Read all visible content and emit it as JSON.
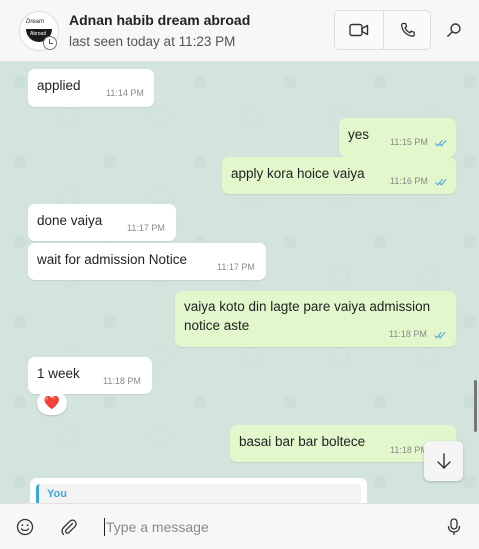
{
  "header": {
    "contact_name": "Adnan habib dream abroad",
    "last_seen": "last seen today at 11:23 PM",
    "avatar_text_top": "Dream",
    "avatar_text_bottom": "Abroad",
    "icons": [
      "video-call-icon",
      "voice-call-icon",
      "search-icon"
    ]
  },
  "messages": [
    {
      "dir": "in",
      "text": "applied",
      "time": "11:14 PM"
    },
    {
      "dir": "out",
      "text": "yes",
      "time": "11:15 PM",
      "read": true
    },
    {
      "dir": "out",
      "text": "apply kora hoice vaiya",
      "time": "11:16 PM",
      "read": true
    },
    {
      "dir": "in",
      "text": "done vaiya",
      "time": "11:17 PM"
    },
    {
      "dir": "in",
      "text": "wait for admission Notice",
      "time": "11:17 PM"
    },
    {
      "dir": "out",
      "text": "vaiya koto din lagte pare vaiya admission notice aste",
      "time": "11:18 PM",
      "read": true
    },
    {
      "dir": "in",
      "text": "1 week",
      "time": "11:18 PM",
      "reaction": "❤️"
    },
    {
      "dir": "out",
      "text": "basai bar bar boltece",
      "time": "11:18 PM"
    }
  ],
  "quoted": {
    "sender": "You"
  },
  "composer": {
    "placeholder": "Type a message",
    "value": ""
  },
  "colors": {
    "incoming": "#ffffff",
    "outgoing": "#e2f7cb",
    "read_ticks": "#4fa3e0",
    "chat_bg": "#d3e4dc"
  }
}
